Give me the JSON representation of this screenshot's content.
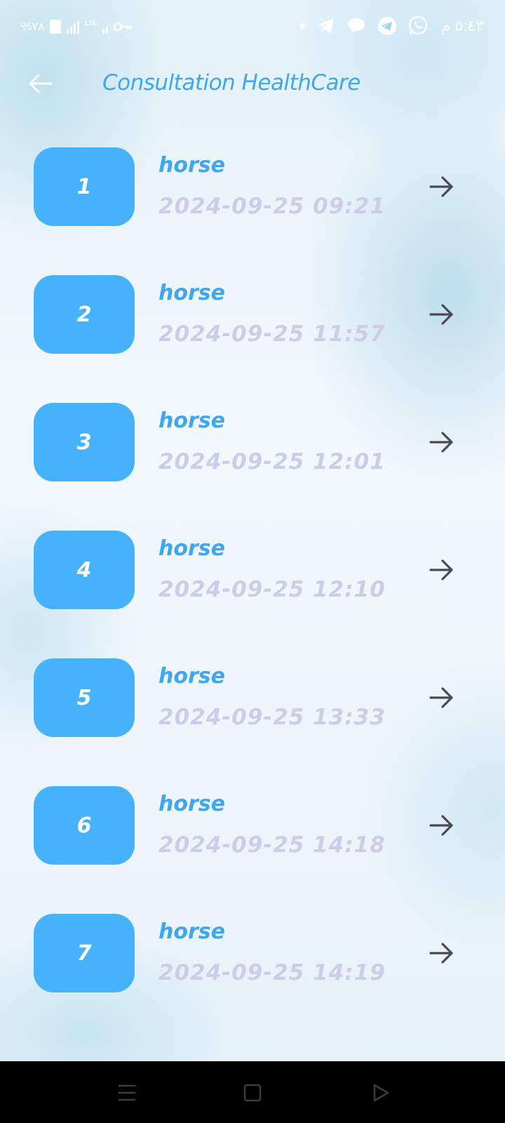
{
  "status_bar": {
    "battery_text": "%٧٨",
    "lte_label": "LTE",
    "time": "٥:٤٣ م",
    "notification_icons": [
      "telegram-icon",
      "message-icon",
      "telegram-icon",
      "whatsapp-icon"
    ]
  },
  "header": {
    "title": "Consultation HealthCare",
    "back_icon": "arrow-left-icon"
  },
  "colors": {
    "accent": "#46b2fb",
    "title": "#3ea7ef",
    "date": "#cfcbe8",
    "arrow": "#4a4a55"
  },
  "consultations": [
    {
      "number": "1",
      "name": "horse",
      "datetime": "2024-09-25 09:21"
    },
    {
      "number": "2",
      "name": "horse",
      "datetime": "2024-09-25 11:57"
    },
    {
      "number": "3",
      "name": "horse",
      "datetime": "2024-09-25 12:01"
    },
    {
      "number": "4",
      "name": "horse",
      "datetime": "2024-09-25 12:10"
    },
    {
      "number": "5",
      "name": "horse",
      "datetime": "2024-09-25 13:33"
    },
    {
      "number": "6",
      "name": "horse",
      "datetime": "2024-09-25 14:18"
    },
    {
      "number": "7",
      "name": "horse",
      "datetime": "2024-09-25 14:19"
    }
  ],
  "nav_bar": {
    "buttons": [
      "menu-icon",
      "home-square-icon",
      "back-triangle-icon"
    ]
  }
}
